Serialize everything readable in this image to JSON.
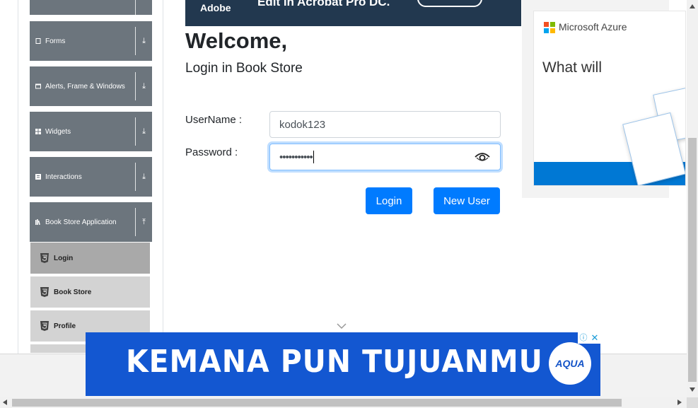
{
  "nav": {
    "groups": [
      {
        "label": "Forms",
        "icon": "file-icon"
      },
      {
        "label": "Alerts, Frame & Windows",
        "icon": "window-icon"
      },
      {
        "label": "Widgets",
        "icon": "grid-icon"
      },
      {
        "label": "Interactions",
        "icon": "interactions-icon"
      },
      {
        "label": "Book Store Application",
        "icon": "book-store-icon"
      }
    ],
    "book_items": [
      {
        "label": "Login",
        "icon": "html5-icon"
      },
      {
        "label": "Book Store",
        "icon": "html5-icon"
      },
      {
        "label": "Profile",
        "icon": "html5-icon"
      }
    ]
  },
  "top_ad": {
    "brand": "Adobe",
    "text": "Edit in Acrobat Pro DC."
  },
  "login": {
    "title": "Welcome,",
    "subtitle": "Login in Book Store",
    "username_label": "UserName :",
    "username_value": "kodok123",
    "password_label": "Password :",
    "password_dots": "•••••••••••",
    "login_button": "Login",
    "new_user_button": "New User"
  },
  "azure_ad": {
    "brand": "Microsoft Azure",
    "headline": "What will"
  },
  "bottom_ad": {
    "text": "KEMANA PUN TUJUANMU",
    "logo": "AQUA",
    "info": "ⓘ",
    "close": "✕"
  },
  "colors": {
    "primary": "#007bff",
    "nav_group": "#6c757d",
    "aqua_blue": "#1357d1",
    "azure_blue": "#0078d4"
  }
}
